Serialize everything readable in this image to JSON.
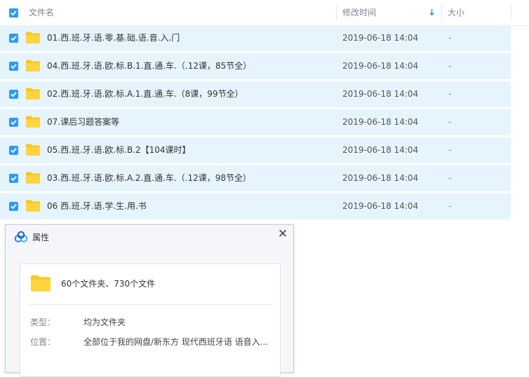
{
  "header": {
    "name_label": "文件名",
    "mtime_label": "修改时间",
    "size_label": "大小"
  },
  "rows": [
    {
      "name": "01.西.班.牙.语.零.基.础.语.音.入.门",
      "mtime": "2019-06-18 14:04",
      "size": "-"
    },
    {
      "name": "04.西.班.牙.语.欧.标.B.1.直.通.车.（.12课，85节全）",
      "mtime": "2019-06-18 14:04",
      "size": "-"
    },
    {
      "name": "02.西.班.牙.语.欧.标.A.1.直.通.车.（8课，99节全）",
      "mtime": "2019-06-18 14:04",
      "size": "-"
    },
    {
      "name": "07.课后习题答案等",
      "mtime": "2019-06-18 14:04",
      "size": "-"
    },
    {
      "name": "05.西.班.牙.语.欧.标.B.2【104课时】",
      "mtime": "2019-06-18 14:04",
      "size": "-"
    },
    {
      "name": "03.西.班.牙.语.欧.标.A.2.直.通.车.（.12课，98节全）",
      "mtime": "2019-06-18 14:04",
      "size": "-"
    },
    {
      "name": "06 西.班.牙.语.学.生.用.书",
      "mtime": "2019-06-18 14:04",
      "size": "-"
    }
  ],
  "dialog": {
    "title": "属性",
    "close": "✕",
    "summary": "60个文件夹、730个文件",
    "type_label": "类型：",
    "type_value": "均为文件夹",
    "location_label": "位置：",
    "location_value": "全部位于我的网盘/新东方 现代西班牙语 语音入..."
  },
  "colors": {
    "accent": "#2e9af5",
    "selected_row": "#e5f4fd",
    "folder": "#ffc61a"
  }
}
